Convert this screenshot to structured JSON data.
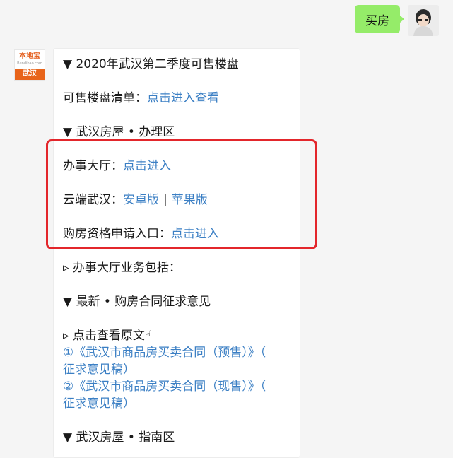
{
  "outgoing": {
    "text": "买房"
  },
  "avatar_logo": {
    "top": "本地宝",
    "mid": "Bendibao.com",
    "bar": "武汉"
  },
  "bubble": {
    "section1": {
      "title": "▼ 2020年武汉第二季度可售楼盘"
    },
    "list_line": {
      "label": "可售楼盘清单：",
      "link": "点击进入查看"
    },
    "section2": {
      "title": "▼ 武汉房屋 • 办理区"
    },
    "hall": {
      "label": "办事大厅：",
      "link": "点击进入"
    },
    "cloud": {
      "label": "云端武汉：",
      "link_android": "安卓版",
      "sep": "|",
      "link_apple": "苹果版"
    },
    "qualify": {
      "label": "购房资格申请入口：",
      "link": "点击进入"
    },
    "business": {
      "text": "▹ 办事大厅业务包括："
    },
    "section3": {
      "title": "▼ 最新 • 购房合同征求意见"
    },
    "view_original": {
      "text": "▹ 点击查看原文☝"
    },
    "doc1": {
      "line1": "①《武汉市商品房买卖合同（预售）》（",
      "line2": "征求意见稿）"
    },
    "doc2": {
      "line1": "②《武汉市商品房买卖合同（现售）》（",
      "line2": "征求意见稿）"
    },
    "section4": {
      "title": "▼ 武汉房屋 • 指南区"
    }
  },
  "colors": {
    "link": "#3b7fc4",
    "highlight": "#e3262b",
    "outgoing_bubble": "#95ec69",
    "logo_orange": "#e8641a"
  }
}
